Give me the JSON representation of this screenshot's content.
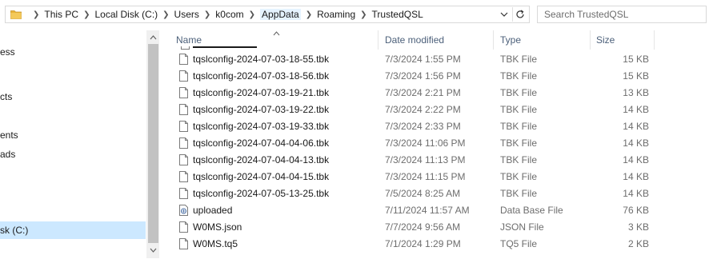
{
  "address_bar": {
    "crumbs": [
      {
        "label": "This PC"
      },
      {
        "label": "Local Disk (C:)"
      },
      {
        "label": "Users"
      },
      {
        "label": "k0com"
      },
      {
        "label": "AppData"
      },
      {
        "label": "Roaming"
      },
      {
        "label": "TrustedQSL"
      }
    ]
  },
  "search": {
    "placeholder": "Search TrustedQSL"
  },
  "nav": {
    "items": [
      {
        "label": "ess"
      },
      {
        "label": "cts"
      },
      {
        "label": "ents"
      },
      {
        "label": "ads"
      },
      {
        "label": "sk (C:)"
      }
    ]
  },
  "columns": {
    "name": "Name",
    "date": "Date modified",
    "type": "Type",
    "size": "Size"
  },
  "files": [
    {
      "name": "tqslconfig-2024-07-03-18-55.tbk",
      "date": "7/3/2024 1:55 PM",
      "type": "TBK File",
      "size": "15 KB",
      "icon": "file-icon"
    },
    {
      "name": "tqslconfig-2024-07-03-18-56.tbk",
      "date": "7/3/2024 1:56 PM",
      "type": "TBK File",
      "size": "15 KB",
      "icon": "file-icon"
    },
    {
      "name": "tqslconfig-2024-07-03-19-21.tbk",
      "date": "7/3/2024 2:21 PM",
      "type": "TBK File",
      "size": "13 KB",
      "icon": "file-icon"
    },
    {
      "name": "tqslconfig-2024-07-03-19-22.tbk",
      "date": "7/3/2024 2:22 PM",
      "type": "TBK File",
      "size": "14 KB",
      "icon": "file-icon"
    },
    {
      "name": "tqslconfig-2024-07-03-19-33.tbk",
      "date": "7/3/2024 2:33 PM",
      "type": "TBK File",
      "size": "14 KB",
      "icon": "file-icon"
    },
    {
      "name": "tqslconfig-2024-07-04-04-06.tbk",
      "date": "7/3/2024 11:06 PM",
      "type": "TBK File",
      "size": "14 KB",
      "icon": "file-icon"
    },
    {
      "name": "tqslconfig-2024-07-04-04-13.tbk",
      "date": "7/3/2024 11:13 PM",
      "type": "TBK File",
      "size": "14 KB",
      "icon": "file-icon"
    },
    {
      "name": "tqslconfig-2024-07-04-04-15.tbk",
      "date": "7/3/2024 11:15 PM",
      "type": "TBK File",
      "size": "14 KB",
      "icon": "file-icon"
    },
    {
      "name": "tqslconfig-2024-07-05-13-25.tbk",
      "date": "7/5/2024 8:25 AM",
      "type": "TBK File",
      "size": "14 KB",
      "icon": "file-icon"
    },
    {
      "name": "uploaded",
      "date": "7/11/2024 11:57 AM",
      "type": "Data Base File",
      "size": "76 KB",
      "icon": "database-file-icon"
    },
    {
      "name": "W0MS.json",
      "date": "7/7/2024 9:56 AM",
      "type": "JSON File",
      "size": "3 KB",
      "icon": "file-icon"
    },
    {
      "name": "W0MS.tq5",
      "date": "7/1/2024 1:29 PM",
      "type": "TQ5 File",
      "size": "2 KB",
      "icon": "file-icon"
    }
  ],
  "colors": {
    "selection": "#cce8ff",
    "header_text": "#4c607a",
    "secondary_text": "#6d6d6d",
    "folder": "#e8b339"
  }
}
